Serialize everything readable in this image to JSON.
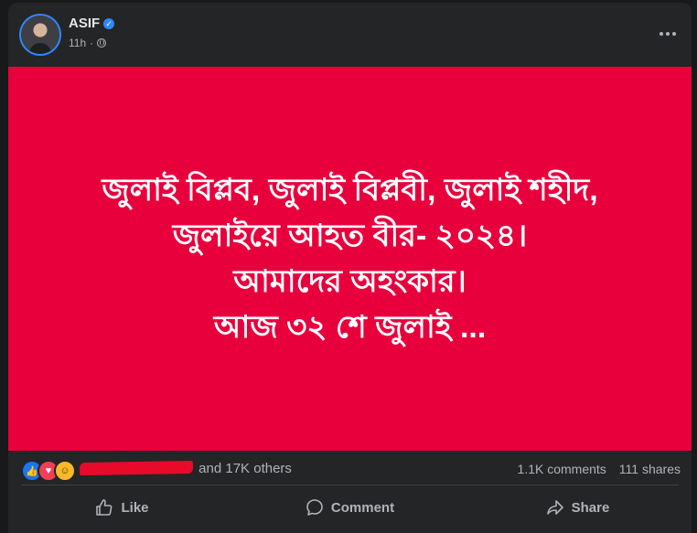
{
  "post": {
    "author": "ASIF",
    "time": "11h",
    "icons": {
      "verified": "verified-badge-icon",
      "privacy": "globe-icon",
      "more": "more-options-icon"
    }
  },
  "image_text": {
    "lines": [
      "জুলাই বিপ্লব, জুলাই বিপ্লবী, জুলাই শহীদ,",
      "জুলাইয়ে আহত বীর- ২০২৪।",
      "আমাদের অহংকার।",
      "আজ ৩২ শে জুলাই ..."
    ],
    "background_color": "#e8003d"
  },
  "reactions": {
    "types": [
      "like",
      "love",
      "haha"
    ],
    "others_text": "and 17K others",
    "comments": "1.1K comments",
    "shares": "111 shares"
  },
  "actions": {
    "like": "Like",
    "comment": "Comment",
    "share": "Share"
  }
}
